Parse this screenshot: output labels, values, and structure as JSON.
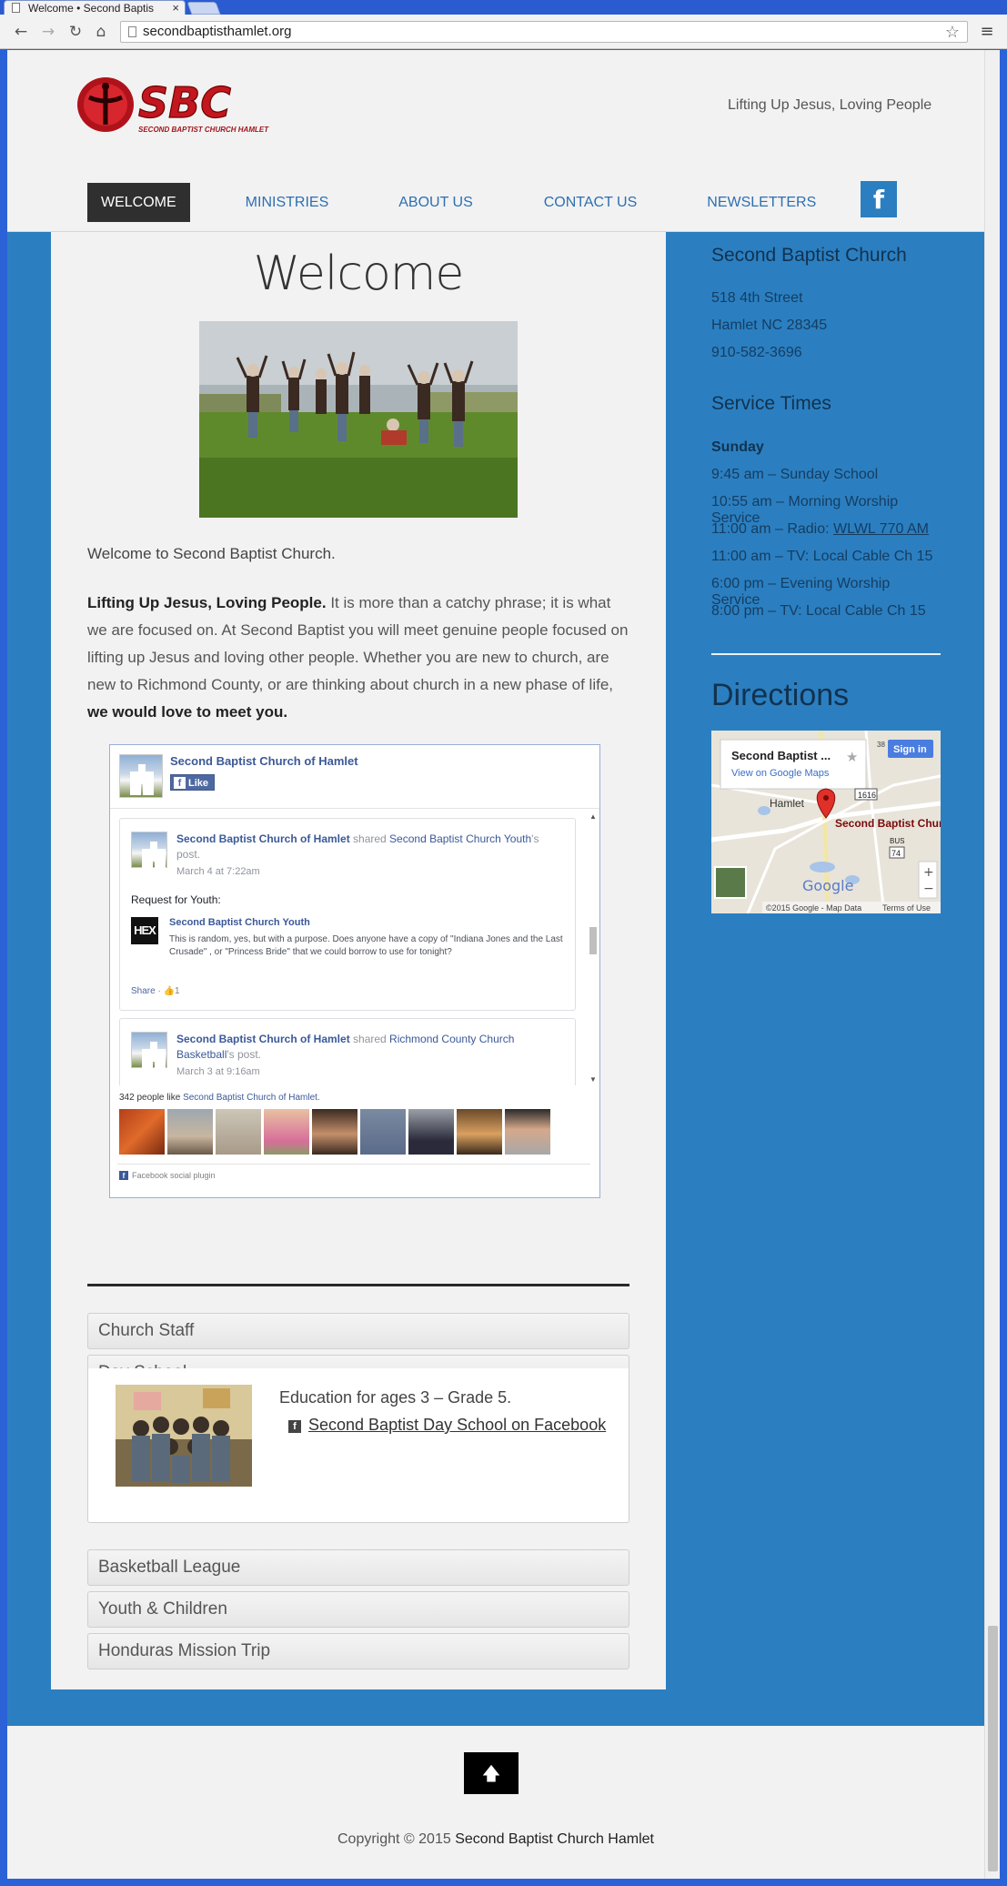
{
  "browser": {
    "tab_title": "Welcome • Second Baptis",
    "tab_close": "×",
    "url": "secondbaptisthamlet.org",
    "back": "←",
    "forward": "→",
    "reload": "↻",
    "home": "⌂",
    "star": "☆",
    "menu": "≡"
  },
  "header": {
    "logo_text": "SBC",
    "logo_sub": "SECOND BAPTIST CHURCH HAMLET",
    "tagline": "Lifting Up Jesus, Loving People",
    "facebook_icon": "f"
  },
  "nav": {
    "items": [
      {
        "label": "WELCOME"
      },
      {
        "label": "MINISTRIES"
      },
      {
        "label": "ABOUT US"
      },
      {
        "label": "CONTACT US"
      },
      {
        "label": "NEWSLETTERS"
      }
    ]
  },
  "main": {
    "title": "Welcome",
    "welcome_line": "Welcome to Second Baptist Church.",
    "intro_bold": "Lifting Up Jesus, Loving People.",
    "intro_text": " It is more than a catchy phrase; it is what we are focused on. At Second Baptist you will meet genuine people focused on lifting up Jesus and loving other people. Whether you are new to church, are new to Richmond County, or are thinking about church in a new phase of life, ",
    "intro_end": "we would love to meet you."
  },
  "facebook": {
    "page_name": "Second Baptist Church of Hamlet",
    "like_label": "Like",
    "like_icon": "f",
    "posts": [
      {
        "author": "Second Baptist Church of Hamlet",
        "verb": " shared ",
        "target": "Second Baptist Church Youth",
        "suffix": "'s post.",
        "date": "March 4 at 7:22am",
        "body": "Request for Youth:",
        "shared_logo": "HEX",
        "shared_name": "Second Baptist Church Youth",
        "shared_text": "This is random, yes, but with a purpose. Does anyone have a copy of \"Indiana Jones and the Last Crusade\" , or \"Princess Bride\" that we could borrow to use for tonight?",
        "share_label": "Share",
        "like_count": "1"
      },
      {
        "author": "Second Baptist Church of Hamlet",
        "verb": " shared ",
        "target": "Richmond County Church Basketball",
        "suffix": "'s post.",
        "date": "March 3 at 9:16am"
      }
    ],
    "likes_prefix": "342 people like ",
    "likes_page": "Second Baptist Church of Hamlet.",
    "plugin_label": "Facebook social plugin"
  },
  "accordion": {
    "items": [
      {
        "label": "Church Staff"
      },
      {
        "label": "Day School"
      },
      {
        "label": "Basketball League"
      },
      {
        "label": "Youth & Children"
      },
      {
        "label": "Honduras Mission Trip"
      }
    ],
    "day_school": {
      "education": "Education for ages 3 – Grade 5.",
      "fb_icon": "f",
      "fb_link": "Second Baptist Day School on Facebook"
    }
  },
  "sidebar": {
    "church_name": "Second Baptist Church",
    "address1": "518 4th Street",
    "address2": "Hamlet NC 28345",
    "phone": "910-582-3696",
    "service_heading": "Service Times",
    "day": "Sunday",
    "times": [
      {
        "text": "9:45 am – Sunday School"
      },
      {
        "text": "10:55 am – Morning Worship Service"
      },
      {
        "text": "11:00 am – Radio: ",
        "link": "WLWL 770 AM"
      },
      {
        "text": "11:00 am – TV: Local Cable Ch 15"
      },
      {
        "text": "6:00 pm – Evening Worship Service"
      },
      {
        "text": "8:00 pm – TV: Local Cable Ch 15"
      }
    ],
    "directions_heading": "Directions",
    "map": {
      "place_name": "Second Baptist ...",
      "view_link": "View on Google Maps",
      "sign_in": "Sign in",
      "marker_label": "Second Baptist Church",
      "town": "Hamlet",
      "road_1616": "1616",
      "road_74": "74",
      "road_bus": "BUS",
      "road_38": "38",
      "google": "Google",
      "attribution": "©2015 Google - Map Data",
      "terms": "Terms of Use",
      "zoom_in": "+",
      "zoom_out": "−",
      "star": "★"
    }
  },
  "footer": {
    "to_top": "🡅",
    "copyright_prefix": "Copyright © 2015 ",
    "org": "Second Baptist Church Hamlet"
  }
}
